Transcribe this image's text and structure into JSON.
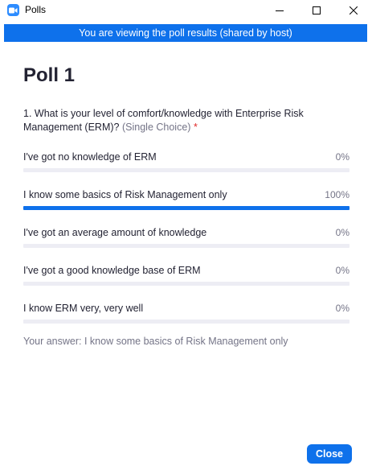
{
  "window": {
    "title": "Polls",
    "app_icon": "zoom-camera-icon",
    "controls": [
      "minimize-icon",
      "maximize-icon",
      "close-icon"
    ]
  },
  "banner": {
    "text": "You are viewing the poll results (shared by host)",
    "color": "#0e71eb"
  },
  "poll": {
    "title": "Poll 1",
    "question": {
      "text": "1. What is your level of comfort/knowledge with Enterprise Risk Management (ERM)?",
      "type": "(Single Choice)",
      "required_marker": "*"
    },
    "options": [
      {
        "label": "I've got no knowledge of ERM",
        "percent_label": "0%",
        "percent": 0
      },
      {
        "label": "I know some basics of Risk Management only",
        "percent_label": "100%",
        "percent": 100
      },
      {
        "label": "I've got an average amount of knowledge",
        "percent_label": "0%",
        "percent": 0
      },
      {
        "label": "I've got a good knowledge base of ERM",
        "percent_label": "0%",
        "percent": 0
      },
      {
        "label": "I know ERM very, very well",
        "percent_label": "0%",
        "percent": 0
      }
    ],
    "your_answer": "Your answer: I know some basics of Risk Management only"
  },
  "footer": {
    "close_label": "Close"
  },
  "colors": {
    "accent": "#0e71eb",
    "track": "#ededf4",
    "muted_text": "#747487",
    "required": "#e02828"
  }
}
